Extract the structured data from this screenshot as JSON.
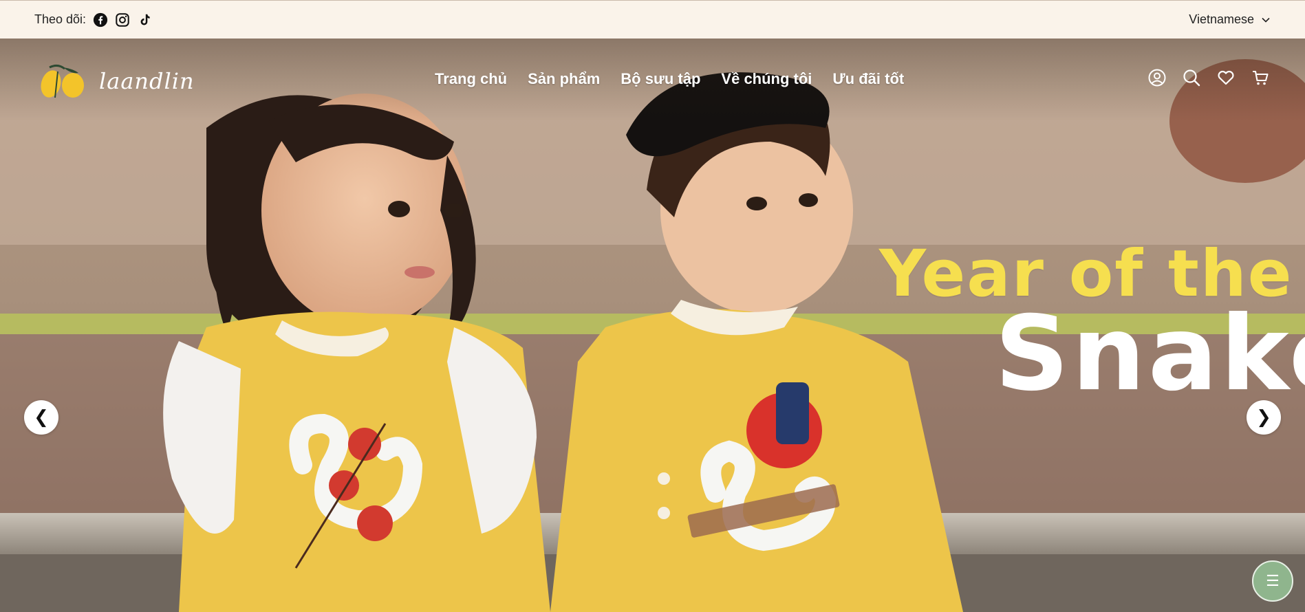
{
  "topbar": {
    "follow_label": "Theo dõi:",
    "socials": [
      "facebook-icon",
      "instagram-icon",
      "tiktok-icon"
    ],
    "language": "Vietnamese"
  },
  "header": {
    "logo_text": "laandlin",
    "nav": [
      "Trang chủ",
      "Sản phẩm",
      "Bộ sưu tập",
      "Về chúng tôi",
      "Ưu đãi tốt"
    ],
    "icons": [
      "account-icon",
      "search-icon",
      "wishlist-icon",
      "cart-icon"
    ]
  },
  "hero": {
    "headline_line1": "Year of the",
    "headline_line2": "Snake",
    "prev_label": "❮",
    "next_label": "❯",
    "menu_label": "☰"
  },
  "colors": {
    "topbar_bg": "#faf3ea",
    "headline_yellow": "#f6df4f",
    "fab_green": "#8fb58d"
  }
}
